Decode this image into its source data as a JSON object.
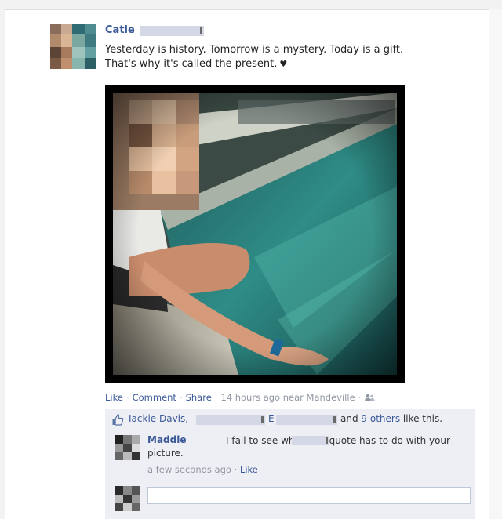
{
  "post": {
    "author": "Catie",
    "status_line1": "Yesterday is history. Tomorrow is a mystery. Today is a gift.",
    "status_line2": "That's why it's called the present.",
    "heart": "♥",
    "photo_icon": "photo-image"
  },
  "actions": {
    "like": "Like",
    "comment": "Comment",
    "share": "Share",
    "timestamp": "14 hours ago near Mandeville",
    "separator": "·",
    "audience_icon": "friends-icon"
  },
  "likes": {
    "liker1": "Jackie Davis",
    "liker2_initial": "E",
    "others": "9 others",
    "and": "and",
    "suffix": "like this."
  },
  "comment": {
    "author": "Maddie",
    "text": "I fail to see what that quote has to do with your picture.",
    "time": "a few seconds ago",
    "like": "Like"
  },
  "write_comment": {
    "placeholder": ""
  },
  "colors": {
    "link": "#3b5998",
    "ufi_bg": "#edeff4",
    "meta": "#9197a3"
  }
}
